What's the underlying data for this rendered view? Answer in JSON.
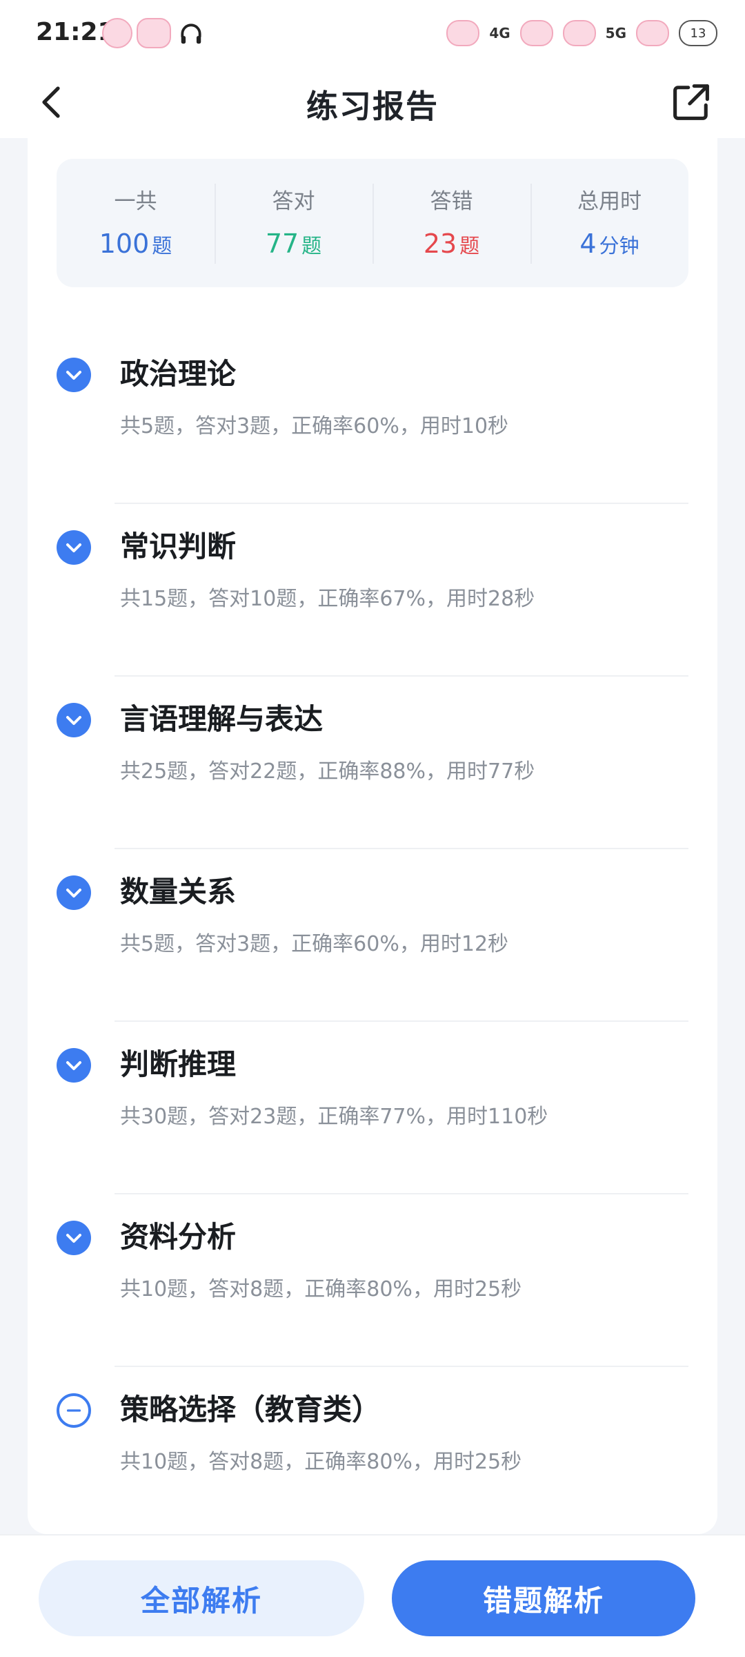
{
  "status_bar": {
    "time": "21:21",
    "net1": "4G",
    "net2": "5G",
    "battery": "13"
  },
  "header": {
    "title": "练习报告"
  },
  "summary": [
    {
      "label": "一共",
      "value": "100",
      "unit": "题",
      "color": "#3a72d8"
    },
    {
      "label": "答对",
      "value": "77",
      "unit": "题",
      "color": "#25b487"
    },
    {
      "label": "答错",
      "value": "23",
      "unit": "题",
      "color": "#e5484d"
    },
    {
      "label": "总用时",
      "value": "4",
      "unit": "分钟",
      "color": "#3a72d8"
    }
  ],
  "sections": [
    {
      "title": "政治理论",
      "stats": "共5题，答对3题，正确率60%，用时10秒",
      "icon": "chevron-down-icon"
    },
    {
      "title": "常识判断",
      "stats": "共15题，答对10题，正确率67%，用时28秒",
      "icon": "chevron-down-icon"
    },
    {
      "title": "言语理解与表达",
      "stats": "共25题，答对22题，正确率88%，用时77秒",
      "icon": "chevron-down-icon"
    },
    {
      "title": "数量关系",
      "stats": "共5题，答对3题，正确率60%，用时12秒",
      "icon": "chevron-down-icon"
    },
    {
      "title": "判断推理",
      "stats": "共30题，答对23题，正确率77%，用时110秒",
      "icon": "chevron-down-icon"
    },
    {
      "title": "资料分析",
      "stats": "共10题，答对8题，正确率80%，用时25秒",
      "icon": "chevron-down-icon"
    },
    {
      "title": "策略选择（教育类）",
      "stats": "共10题，答对8题，正确率80%，用时25秒",
      "icon": "minus-circle-icon"
    }
  ],
  "actions": {
    "all_label": "全部解析",
    "wrong_label": "错题解析"
  },
  "colors": {
    "accent": "#3d7cf0",
    "correct": "#25b487",
    "wrong": "#e5484d"
  }
}
